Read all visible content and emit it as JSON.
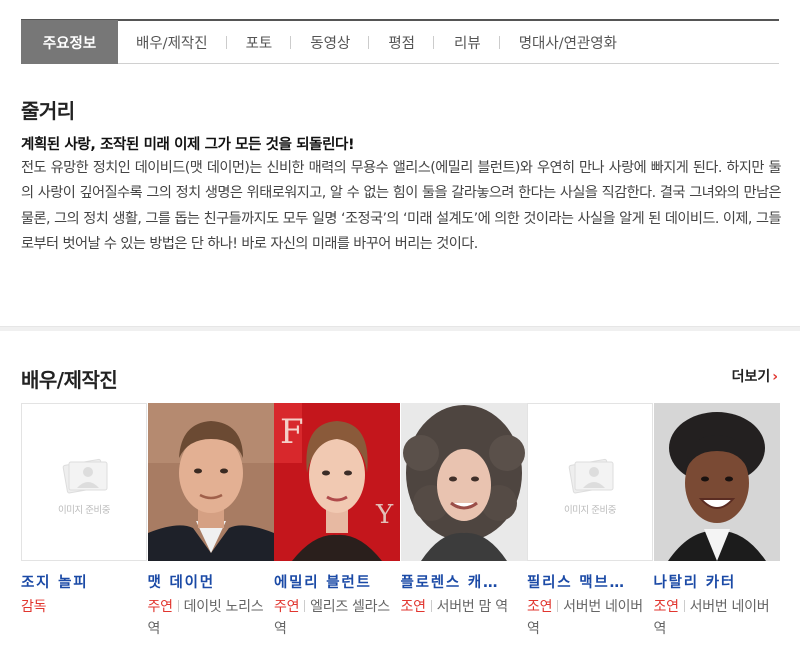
{
  "tabs": [
    {
      "label": "주요정보",
      "active": true
    },
    {
      "label": "배우/제작진"
    },
    {
      "label": "포토"
    },
    {
      "label": "동영상"
    },
    {
      "label": "평점"
    },
    {
      "label": "리뷰"
    },
    {
      "label": "명대사/연관영화"
    }
  ],
  "synopsis": {
    "title": "줄거리",
    "headline": "계획된 사랑, 조작된 미래 이제 그가 모든 것을 되돌린다!",
    "body": "전도 유망한 정치인 데이비드(맷 데이먼)는 신비한 매력의 무용수 앨리스(에밀리 블런트)와 우연히 만나 사랑에 빠지게 된다. 하지만 둘의 사랑이 깊어질수록 그의 정치 생명은 위태로워지고, 알 수 없는 힘이 둘을 갈라놓으려 한다는 사실을 직감한다. 결국 그녀와의 만남은 물론, 그의 정치 생활, 그를 돕는 친구들까지도 모두 일명 ‘조정국’의 ‘미래 설계도’에 의한 것이라는 사실을 알게 된 데이비드. 이제, 그들로부터 벗어날 수 있는 방법은 단 하나! 바로 자신의 미래를 바꾸어 버리는 것이다."
  },
  "cast_section": {
    "title": "배우/제작진",
    "more": "더보기",
    "placeholder_text": "이미지 준비중",
    "people": [
      {
        "name": "조지 놀피",
        "role": "감독",
        "character": "",
        "photo": "placeholder"
      },
      {
        "name": "맷 데이먼",
        "role": "주연",
        "character": "데이빗 노리스 역",
        "photo": "man-short-hair"
      },
      {
        "name": "에밀리 블런트",
        "role": "주연",
        "character": "엘리즈 셀라스 역",
        "photo": "woman-updo"
      },
      {
        "name": "플로렌스 캐…",
        "role": "조연",
        "character": "서버번 맘 역",
        "photo": "woman-curly"
      },
      {
        "name": "필리스 맥브…",
        "role": "조연",
        "character": "서버번 네이버 역",
        "photo": "placeholder"
      },
      {
        "name": "나탈리 카터",
        "role": "조연",
        "character": "서버번 네이버 역",
        "photo": "woman-smile"
      }
    ]
  },
  "colors": {
    "accent": "#e1362f",
    "link": "#1b4aa6",
    "tab_active": "#777777"
  }
}
